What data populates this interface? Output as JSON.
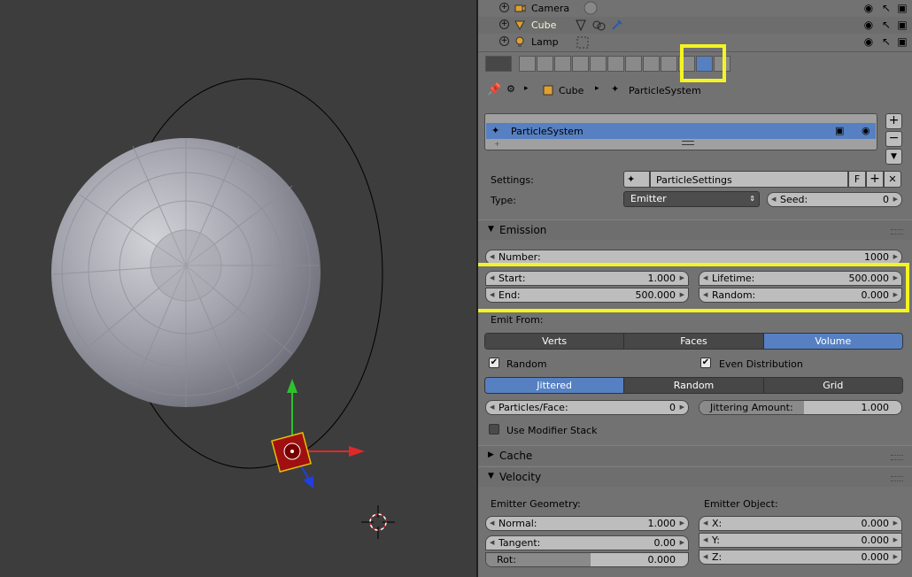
{
  "outliner": {
    "items": [
      {
        "name": "Camera",
        "icon": "camera-icon"
      },
      {
        "name": "Cube",
        "icon": "mesh-cube-icon"
      },
      {
        "name": "Lamp",
        "icon": "lamp-icon"
      }
    ]
  },
  "breadcrumb": {
    "object": "Cube",
    "particle_system": "ParticleSystem"
  },
  "particle_list": {
    "item": "ParticleSystem"
  },
  "settings": {
    "label": "Settings:",
    "value": "ParticleSettings",
    "fake_user": "F"
  },
  "type": {
    "label": "Type:",
    "value": "Emitter"
  },
  "seed": {
    "label": "Seed:",
    "value": "0"
  },
  "emission": {
    "title": "Emission",
    "number_label": "Number:",
    "number_value": "1000",
    "start_label": "Start:",
    "start_value": "1.000",
    "end_label": "End:",
    "end_value": "500.000",
    "lifetime_label": "Lifetime:",
    "lifetime_value": "500.000",
    "random_label": "Random:",
    "random_value": "0.000",
    "emit_from_label": "Emit From:",
    "emit_from_options": [
      "Verts",
      "Faces",
      "Volume"
    ],
    "emit_from_selected": "Volume",
    "random_check_label": "Random",
    "even_distribution_label": "Even Distribution",
    "distribution_options": [
      "Jittered",
      "Random",
      "Grid"
    ],
    "distribution_selected": "Jittered",
    "particles_face_label": "Particles/Face:",
    "particles_face_value": "0",
    "jittering_label": "Jittering Amount:",
    "jittering_value": "1.000",
    "use_modifier_stack_label": "Use Modifier Stack"
  },
  "cache": {
    "title": "Cache"
  },
  "velocity": {
    "title": "Velocity",
    "emitter_geometry_label": "Emitter Geometry:",
    "emitter_object_label": "Emitter Object:",
    "normal_label": "Normal:",
    "normal_value": "1.000",
    "tangent_label": "Tangent:",
    "tangent_value": "0.00",
    "rot_label": "Rot:",
    "rot_value": "0.000",
    "x_label": "X:",
    "x_value": "0.000",
    "y_label": "Y:",
    "y_value": "0.000",
    "z_label": "Z:",
    "z_value": "0.000"
  },
  "colors": {
    "accent_blue": "#5680c2",
    "highlight_yellow": "#f4f422",
    "viewport_bg": "#3d3d3d"
  }
}
